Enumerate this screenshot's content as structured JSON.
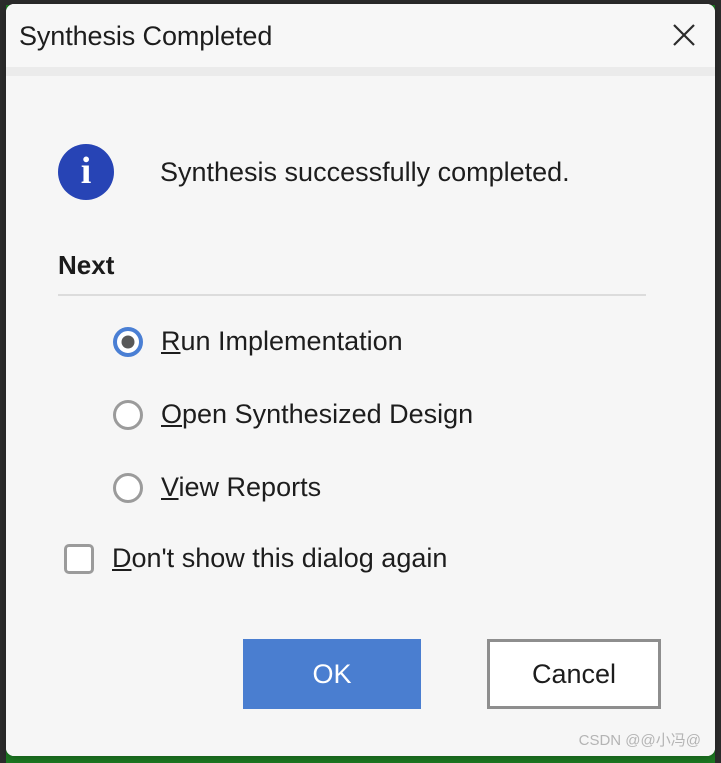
{
  "window": {
    "title": "Synthesis Completed",
    "close_icon": "close-icon"
  },
  "message": {
    "icon": "info-icon",
    "icon_glyph": "i",
    "text": "Synthesis successfully completed."
  },
  "section": {
    "heading": "Next"
  },
  "options": [
    {
      "id": "run-implementation",
      "mnemonic": "R",
      "rest": "un Implementation",
      "selected": true
    },
    {
      "id": "open-synthesized-design",
      "mnemonic": "O",
      "rest": "pen Synthesized Design",
      "selected": false
    },
    {
      "id": "view-reports",
      "mnemonic": "V",
      "rest": "iew Reports",
      "selected": false
    }
  ],
  "checkbox": {
    "mnemonic": "D",
    "rest": "on't show this dialog again",
    "checked": false
  },
  "buttons": {
    "ok": "OK",
    "cancel": "Cancel"
  },
  "watermark": "CSDN @@小冯@",
  "colors": {
    "info_blue": "#2744b5",
    "accent_blue": "#4a7ed0",
    "radio_blue": "#4a7fd4",
    "dialog_bg": "#f6f6f6",
    "border_gray": "#8e8e8e"
  }
}
